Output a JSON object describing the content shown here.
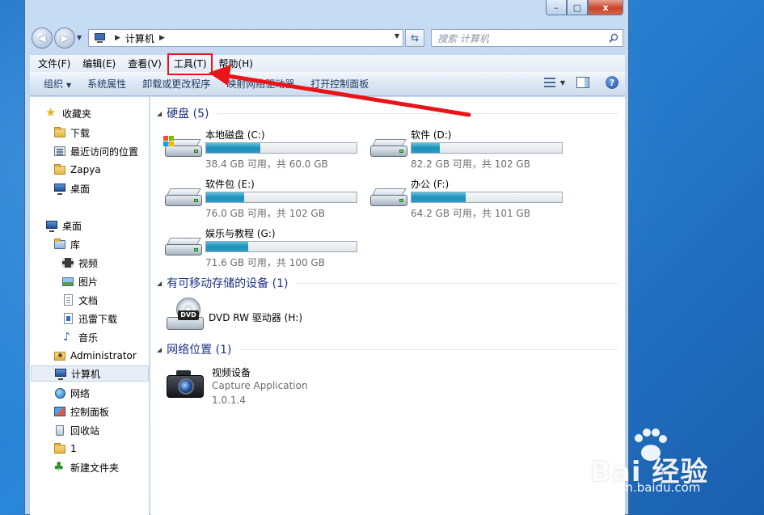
{
  "window": {
    "caption_buttons": {
      "minimize": "–",
      "maximize": "□",
      "close": "x"
    }
  },
  "nav": {
    "back_glyph": "◀",
    "forward_glyph": "▶",
    "address_path": [
      "计算机"
    ],
    "search_placeholder": "搜索 计算机"
  },
  "menu": [
    "文件(F)",
    "编辑(E)",
    "查看(V)",
    "工具(T)",
    "帮助(H)"
  ],
  "toolbar": {
    "items": [
      "组织",
      "系统属性",
      "卸载或更改程序",
      "映射网络驱动器",
      "打开控制面板"
    ],
    "help_glyph": "?"
  },
  "nav_pane": {
    "favorites": [
      {
        "label": "收藏夹",
        "icon": "star-icon"
      },
      {
        "label": "下载",
        "icon": "folder-icon"
      },
      {
        "label": "最近访问的位置",
        "icon": "recent-places-icon"
      },
      {
        "label": "Zapya",
        "icon": "folder-icon"
      },
      {
        "label": "桌面",
        "icon": "desktop-icon"
      }
    ],
    "tree": [
      {
        "label": "桌面",
        "icon": "desktop-icon"
      },
      {
        "label": "库",
        "icon": "library-icon"
      },
      {
        "label": "视频",
        "icon": "video-icon"
      },
      {
        "label": "图片",
        "icon": "picture-icon"
      },
      {
        "label": "文档",
        "icon": "document-icon"
      },
      {
        "label": "迅雷下载",
        "icon": "thunder-icon"
      },
      {
        "label": "音乐",
        "icon": "music-icon"
      },
      {
        "label": "Administrator",
        "icon": "user-folder-icon"
      },
      {
        "label": "计算机",
        "icon": "computer-icon",
        "selected": true
      },
      {
        "label": "网络",
        "icon": "network-icon"
      },
      {
        "label": "控制面板",
        "icon": "control-panel-icon"
      },
      {
        "label": "回收站",
        "icon": "recycle-bin-icon"
      },
      {
        "label": "1",
        "icon": "folder-icon"
      },
      {
        "label": "新建文件夹",
        "icon": "tree-icon"
      }
    ]
  },
  "content": {
    "groups": [
      "硬盘 (5)",
      "有可移动存储的设备 (1)",
      "网络位置 (1)"
    ],
    "drives": [
      {
        "name": "本地磁盘 (C:)",
        "free": "38.4 GB 可用，共 60.0 GB",
        "used_fraction": 0.36,
        "system": true
      },
      {
        "name": "软件 (D:)",
        "free": "82.2 GB 可用，共 102 GB",
        "used_fraction": 0.19
      },
      {
        "name": "软件包 (E:)",
        "free": "76.0 GB 可用，共 102 GB",
        "used_fraction": 0.25
      },
      {
        "name": "办公 (F:)",
        "free": "64.2 GB 可用，共 101 GB",
        "used_fraction": 0.36
      },
      {
        "name": "娱乐与教程 (G:)",
        "free": "71.6 GB 可用，共 100 GB",
        "used_fraction": 0.28
      }
    ],
    "removable": {
      "name": "DVD RW 驱动器 (H:)",
      "badge": "DVD"
    },
    "network": {
      "name": "视频设备",
      "line2": "Capture Application",
      "line3": "1.0.1.4"
    }
  },
  "colors": {
    "bar_fill": "#1f8fb8",
    "highlight": "#e8141a",
    "group_header": "#1e3287"
  },
  "watermark": {
    "text": "Bai 经验",
    "url": "jingyan.baidu.com"
  }
}
